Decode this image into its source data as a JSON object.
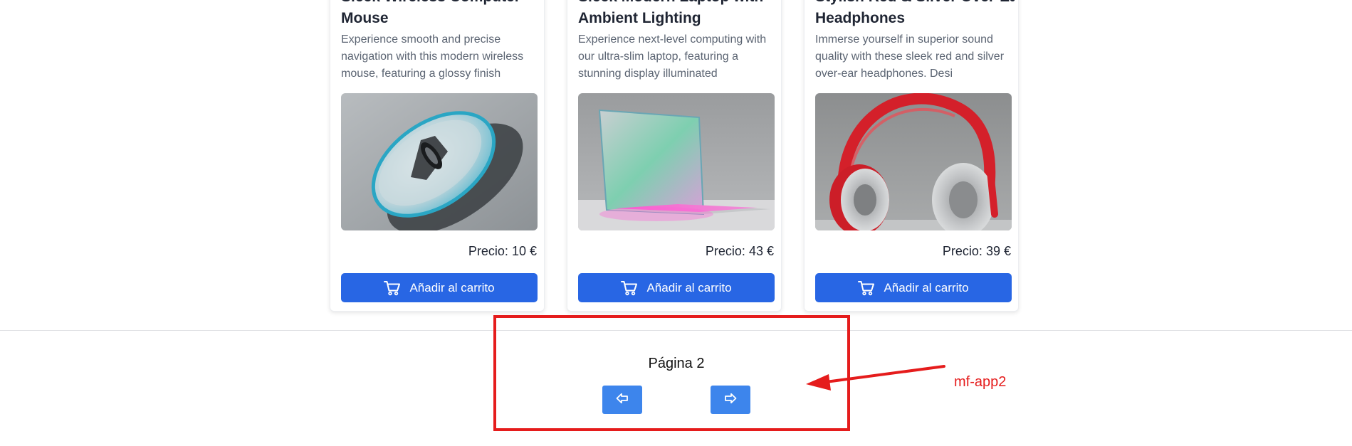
{
  "products": [
    {
      "title_line1": "Sleek Wireless Computer",
      "title_line2": "Mouse",
      "description": "Experience smooth and precise navigation with this modern wireless mouse, featuring a glossy finish",
      "price_label": "Precio:",
      "price_value": "10 €",
      "button_label": "Añadir al carrito",
      "image": "wireless-mouse-photo"
    },
    {
      "title_line1": "Sleek Modern Laptop with",
      "title_line2": "Ambient Lighting",
      "description": "Experience next-level computing with our ultra-slim laptop, featuring a stunning display illuminated",
      "price_label": "Precio:",
      "price_value": "43 €",
      "button_label": "Añadir al carrito",
      "image": "laptop-photo"
    },
    {
      "title_line1": "Stylish Red & Silver Over-Ear",
      "title_line2": "Headphones",
      "description": "Immerse yourself in superior sound quality with these sleek red and silver over-ear headphones. Desi",
      "price_label": "Precio:",
      "price_value": "39 €",
      "button_label": "Añadir al carrito",
      "image": "headphones-photo"
    }
  ],
  "pagination": {
    "label": "Página 2",
    "prev_icon": "arrow-left-icon",
    "next_icon": "arrow-right-icon"
  },
  "annotation": {
    "label": "mf-app2",
    "color": "#e51c1c"
  },
  "colors": {
    "button_primary": "#2866e4",
    "nav_button": "#3d85ec",
    "title_text": "#1f2533",
    "desc_text": "#5b6472"
  }
}
